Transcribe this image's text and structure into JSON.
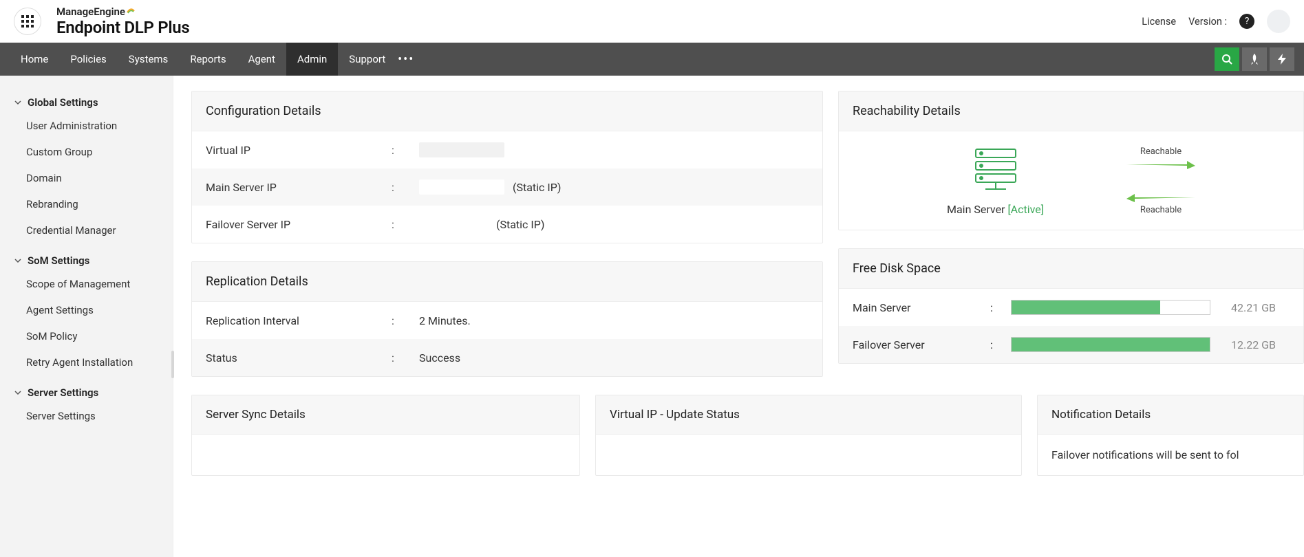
{
  "header": {
    "brand_top": "ManageEngine",
    "brand_main": "Endpoint DLP Plus",
    "license": "License",
    "version": "Version :"
  },
  "nav": {
    "items": [
      "Home",
      "Policies",
      "Systems",
      "Reports",
      "Agent",
      "Admin",
      "Support"
    ],
    "active_index": 5
  },
  "sidebar": {
    "sections": [
      {
        "title": "Global Settings",
        "items": [
          "User Administration",
          "Custom Group",
          "Domain",
          "Rebranding",
          "Credential Manager"
        ]
      },
      {
        "title": "SoM Settings",
        "items": [
          "Scope of Management",
          "Agent Settings",
          "SoM Policy",
          "Retry Agent Installation"
        ]
      },
      {
        "title": "Server Settings",
        "items": [
          "Server Settings"
        ]
      }
    ]
  },
  "config_card": {
    "title": "Configuration Details",
    "rows": {
      "virtual_ip_label": "Virtual IP",
      "main_server_ip_label": "Main Server IP",
      "main_server_ip_note": "(Static IP)",
      "failover_server_ip_label": "Failover Server IP",
      "failover_server_ip_note": "(Static IP)"
    }
  },
  "replication_card": {
    "title": "Replication Details",
    "interval_label": "Replication Interval",
    "interval_value": "2 Minutes.",
    "status_label": "Status",
    "status_value": "Success"
  },
  "reach_card": {
    "title": "Reachability Details",
    "main_server_label": "Main Server ",
    "main_server_status": "[Active]",
    "reachable_top": "Reachable",
    "reachable_bottom": "Reachable"
  },
  "disk_card": {
    "title": "Free Disk Space",
    "main_label": "Main Server",
    "main_value": "42.21 GB",
    "main_pct": 75,
    "failover_label": "Failover Server",
    "failover_value": "12.22 GB",
    "failover_pct": 100
  },
  "bottom_cards": {
    "sync_title": "Server Sync Details",
    "vip_title": "Virtual IP - Update Status",
    "notif_title": "Notification Details",
    "notif_body": "Failover notifications will be sent to fol"
  }
}
